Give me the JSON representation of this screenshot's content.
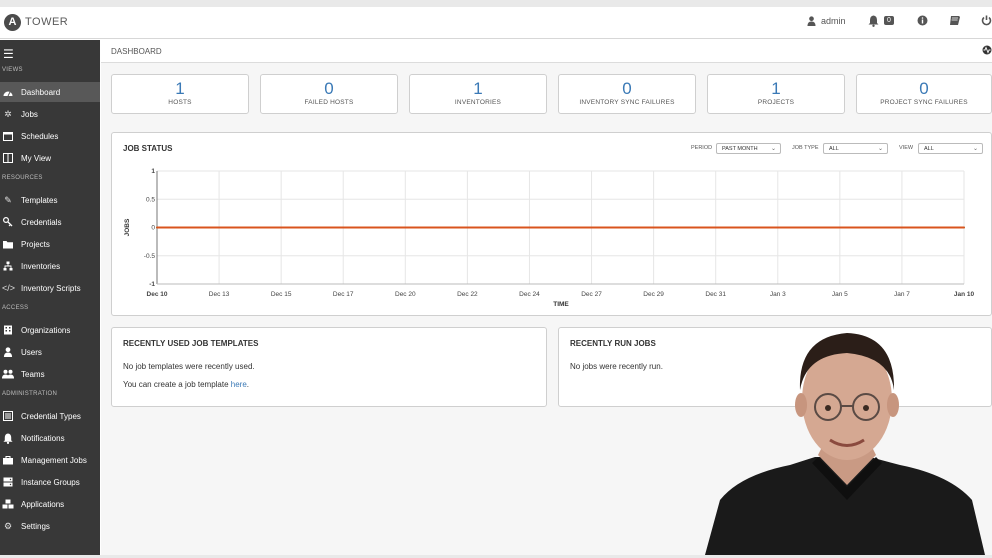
{
  "header": {
    "brand": "TOWER",
    "logo_letter": "A",
    "user": "admin",
    "notification_count": "0",
    "icons": [
      "user-icon",
      "bell-icon",
      "info-icon",
      "book-icon",
      "power-icon"
    ]
  },
  "sidebar": {
    "sections": [
      {
        "label": "VIEWS",
        "items": [
          {
            "label": "Dashboard",
            "icon": "dashboard-icon",
            "active": true
          },
          {
            "label": "Jobs",
            "icon": "jobs-icon"
          },
          {
            "label": "Schedules",
            "icon": "calendar-icon"
          },
          {
            "label": "My View",
            "icon": "columns-icon"
          }
        ]
      },
      {
        "label": "RESOURCES",
        "items": [
          {
            "label": "Templates",
            "icon": "pencil-icon"
          },
          {
            "label": "Credentials",
            "icon": "key-icon"
          },
          {
            "label": "Projects",
            "icon": "folder-icon"
          },
          {
            "label": "Inventories",
            "icon": "sitemap-icon"
          },
          {
            "label": "Inventory Scripts",
            "icon": "code-icon"
          }
        ]
      },
      {
        "label": "ACCESS",
        "items": [
          {
            "label": "Organizations",
            "icon": "building-icon"
          },
          {
            "label": "Users",
            "icon": "user-icon"
          },
          {
            "label": "Teams",
            "icon": "users-icon"
          }
        ]
      },
      {
        "label": "ADMINISTRATION",
        "items": [
          {
            "label": "Credential Types",
            "icon": "list-alt-icon"
          },
          {
            "label": "Notifications",
            "icon": "bell-icon"
          },
          {
            "label": "Management Jobs",
            "icon": "briefcase-icon"
          },
          {
            "label": "Instance Groups",
            "icon": "server-icon"
          },
          {
            "label": "Applications",
            "icon": "cubes-icon"
          },
          {
            "label": "Settings",
            "icon": "cog-icon"
          }
        ]
      }
    ]
  },
  "breadcrumb": "DASHBOARD",
  "stats": [
    {
      "value": "1",
      "label": "HOSTS"
    },
    {
      "value": "0",
      "label": "FAILED HOSTS"
    },
    {
      "value": "1",
      "label": "INVENTORIES"
    },
    {
      "value": "0",
      "label": "INVENTORY SYNC FAILURES"
    },
    {
      "value": "1",
      "label": "PROJECTS"
    },
    {
      "value": "0",
      "label": "PROJECT SYNC FAILURES"
    }
  ],
  "job_status": {
    "title": "JOB STATUS",
    "filters": {
      "period_label": "PERIOD",
      "period_value": "PAST MONTH",
      "job_type_label": "JOB TYPE",
      "job_type_value": "ALL",
      "view_label": "VIEW",
      "view_value": "ALL"
    }
  },
  "chart_data": {
    "type": "line",
    "title": "",
    "xlabel": "TIME",
    "ylabel": "JOBS",
    "ylim": [
      -1,
      1
    ],
    "yticks": [
      "1",
      "0.5",
      "0",
      "-0.5",
      "-1"
    ],
    "x": [
      "Dec 10",
      "Dec 13",
      "Dec 15",
      "Dec 17",
      "Dec 20",
      "Dec 22",
      "Dec 24",
      "Dec 27",
      "Dec 29",
      "Dec 31",
      "Jan 3",
      "Jan 5",
      "Jan 7",
      "Jan 10"
    ],
    "series": [
      {
        "values": [
          0,
          0,
          0,
          0,
          0,
          0,
          0,
          0,
          0,
          0,
          0,
          0,
          0,
          0
        ],
        "color": "#d9541e"
      },
      {
        "values": [
          0,
          0,
          0,
          0,
          0,
          0,
          0,
          0,
          0,
          0,
          0,
          0,
          0,
          0
        ],
        "color": "#5cb85c"
      }
    ],
    "grid": true,
    "legend": "none"
  },
  "recent_templates": {
    "title": "RECENTLY USED JOB TEMPLATES",
    "empty": "No job templates were recently used.",
    "create_prefix": "You can create a job template ",
    "create_link": "here",
    "create_suffix": "."
  },
  "recent_jobs": {
    "title": "RECENTLY RUN JOBS",
    "empty": "No jobs were recently run."
  },
  "colors": {
    "accent": "#3a79b6",
    "sidebar": "#383838",
    "sidebar_active": "#585858",
    "failed_line": "#d9541e"
  }
}
